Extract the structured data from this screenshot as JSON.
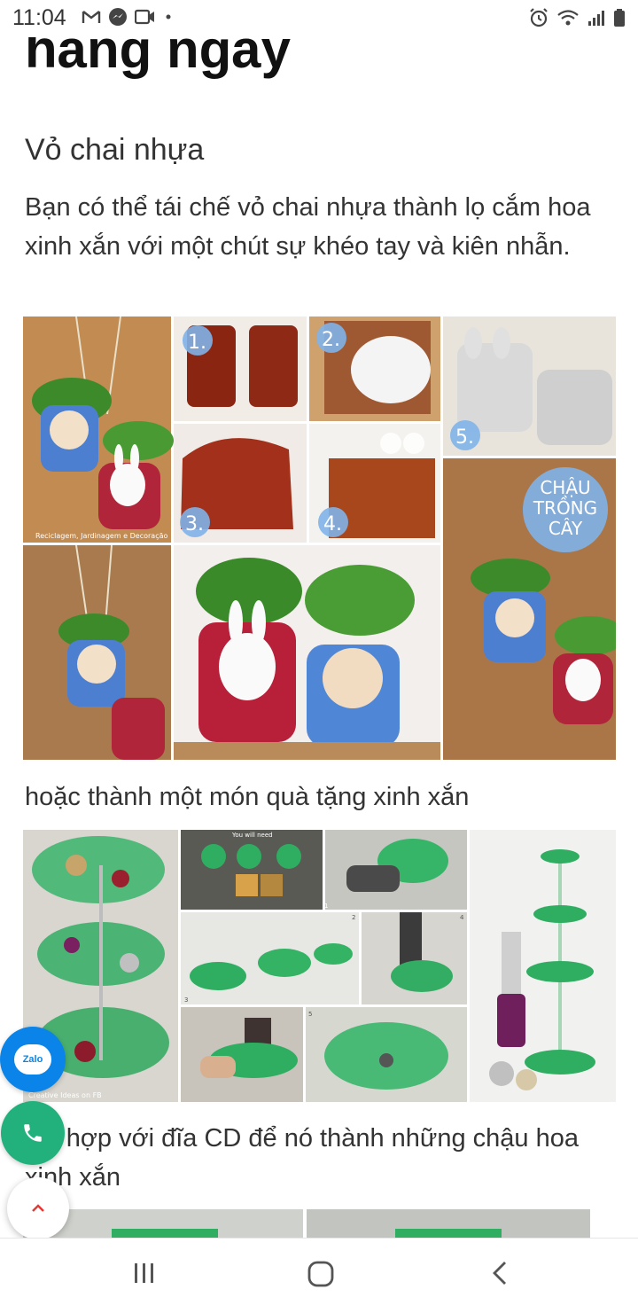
{
  "status_bar": {
    "time": "11:04",
    "left_icons": [
      "gmail-icon",
      "messenger-icon",
      "video-icon",
      "dot-icon"
    ],
    "right_icons": [
      "alarm-icon",
      "wifi-icon",
      "signal-icon",
      "battery-icon"
    ]
  },
  "article": {
    "heading_partial": "hàng ngày",
    "section_title": "Vỏ chai nhựa",
    "paragraph": "Bạn có thể tái chế vỏ chai nhựa thành lọ cắm hoa xinh xắn với một chút sự khéo tay và kiên nhẫn.",
    "image1": {
      "step_labels": [
        "1.",
        "2.",
        "3.",
        "4.",
        "5."
      ],
      "badge": [
        "CHẬU",
        "TRỒNG",
        "CÂY"
      ],
      "credit": "Reciclagem, Jardinagem e Decoração"
    },
    "caption2": "hoặc thành một món quà tặng xinh xắn",
    "image2": {
      "panel_title": "You will need",
      "step_labels": [
        "1",
        "2",
        "3",
        "4",
        "5"
      ],
      "credit": "Creative Ideas on FB"
    },
    "caption3": "kết hợp với đĩa CD để nó thành những chậu hoa xinh xắn"
  },
  "floating": {
    "zalo_label": "Zalo",
    "colors": {
      "zalo": "#0a84e8",
      "phone": "#22b07d",
      "scroll_top_arrow": "#e53935"
    }
  },
  "nav_bar": {
    "buttons": [
      "recent-apps-icon",
      "home-icon",
      "back-icon"
    ]
  }
}
